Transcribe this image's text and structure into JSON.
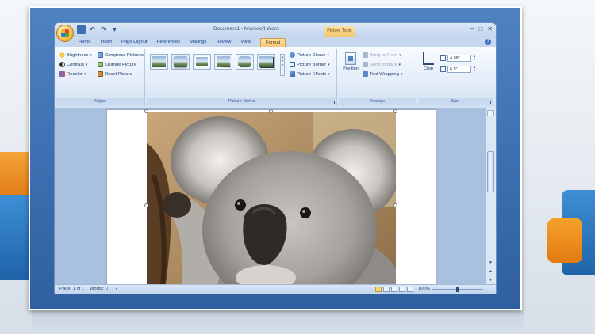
{
  "window": {
    "title": "Document1 - Microsoft Word",
    "context_tab_group": "Picture Tools",
    "controls": {
      "minimize": "–",
      "maximize": "□",
      "close": "✕"
    }
  },
  "quick_access": {
    "undo": "↶",
    "redo": "↷",
    "more": "▾"
  },
  "tabs": [
    "Home",
    "Insert",
    "Page Layout",
    "References",
    "Mailings",
    "Review",
    "View"
  ],
  "active_tab": "Format",
  "ribbon": {
    "adjust": {
      "label": "Adjust",
      "brightness": "Brightness",
      "contrast": "Contrast",
      "recolor": "Recolor",
      "compress": "Compress Pictures",
      "change": "Change Picture",
      "reset": "Reset Picture"
    },
    "picture_styles": {
      "label": "Picture Styles",
      "shape": "Picture Shape",
      "border": "Picture Border",
      "effects": "Picture Effects"
    },
    "arrange": {
      "label": "Arrange",
      "position": "Position",
      "bring_front": "Bring to Front",
      "send_back": "Send to Back",
      "text_wrapping": "Text Wrapping"
    },
    "size": {
      "label": "Size",
      "crop": "Crop",
      "height": "4.88\"",
      "width": "6.5\""
    }
  },
  "status": {
    "page": "Page: 1 of 1",
    "words": "Words: 0",
    "zoom": "100%"
  },
  "colors": {
    "ribbon_accent": "#d59c3b",
    "frame_blue": "#3d70b2"
  }
}
